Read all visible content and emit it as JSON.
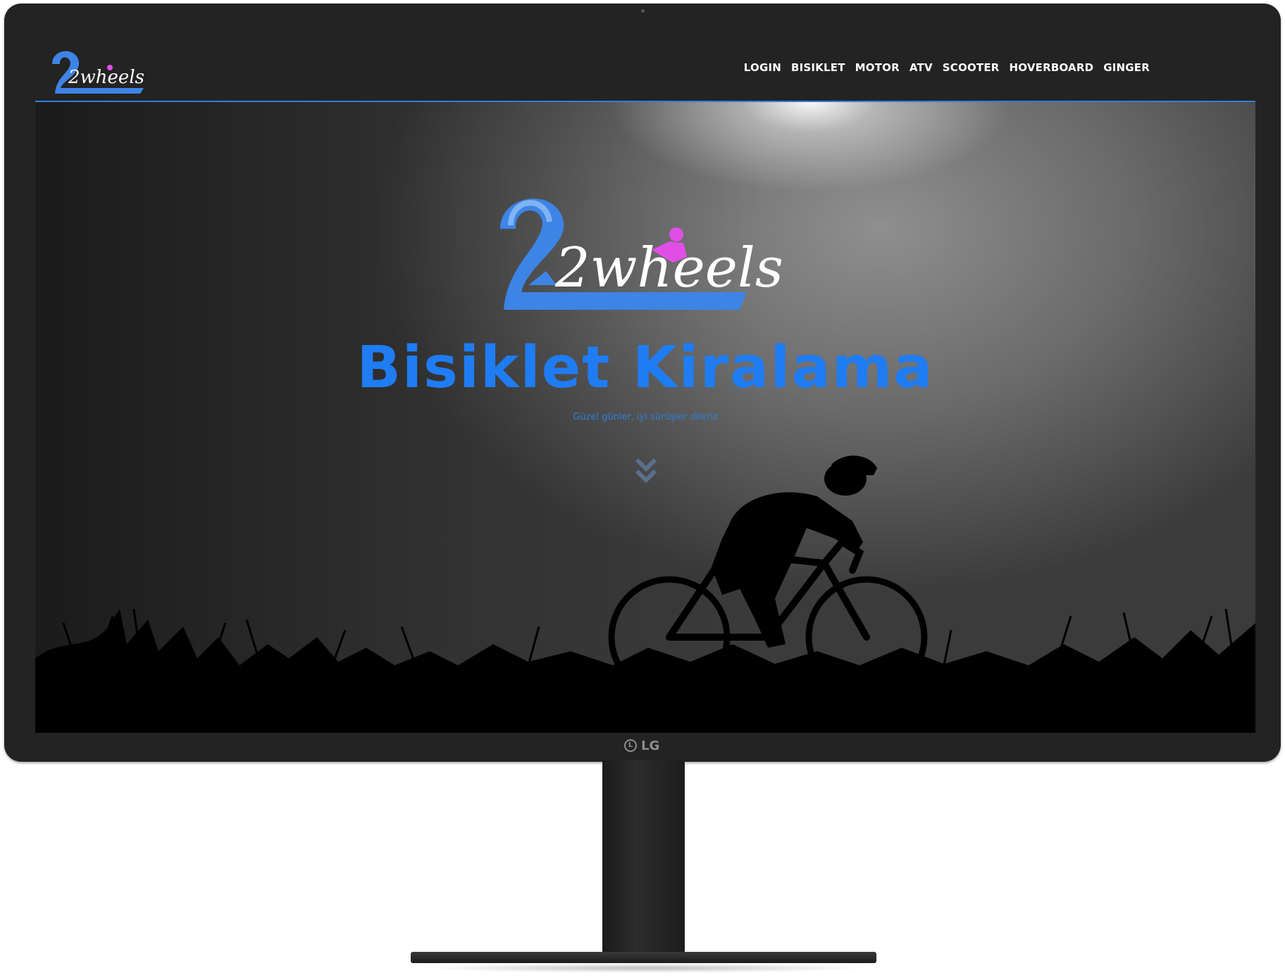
{
  "nav": {
    "logo_text": "2wheels",
    "menu": [
      "LOGIN",
      "BISIKLET",
      "MOTOR",
      "ATV",
      "SCOOTER",
      "HOVERBOARD",
      "GINGER"
    ]
  },
  "hero": {
    "logo_text": "2wheels",
    "title": "Bisiklet Kiralama",
    "subtitle": "Güzel günler, iyi sürüşler dileriz"
  },
  "monitor": {
    "brand": "LG"
  },
  "colors": {
    "accent_blue": "#1f7cf2",
    "logo_pink": "#e14ee6",
    "nav_bg": "#232323"
  }
}
